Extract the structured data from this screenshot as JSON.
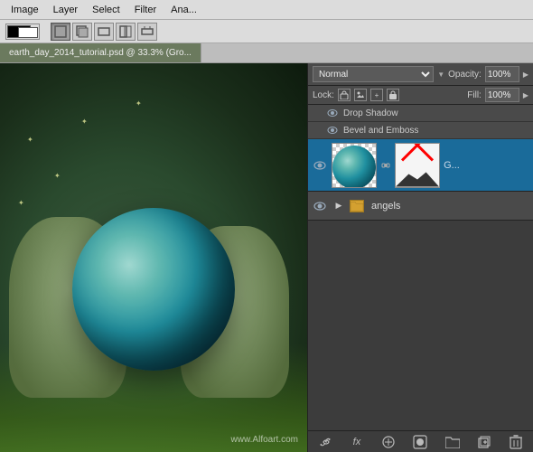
{
  "menubar": {
    "items": [
      "Image",
      "Layer",
      "Select",
      "Filter",
      "Ana..."
    ]
  },
  "options": {
    "swatch_label": "Swatches",
    "tool_buttons": [
      "rect1",
      "rect2",
      "rect3",
      "rect4",
      "rect5"
    ]
  },
  "tab": {
    "label": "earth_day_2014_tutorial.psd @ 33.3% (Gro..."
  },
  "layers_panel": {
    "blend_mode": "Normal",
    "opacity_label": "Opacity:",
    "opacity_value": "100%",
    "lock_label": "Lock:",
    "fill_label": "Fill:",
    "fill_value": "100%",
    "effects": [
      {
        "name": "Drop Shadow"
      },
      {
        "name": "Bevel and Emboss"
      }
    ],
    "layers": [
      {
        "id": "globe-layer",
        "visible": true,
        "type": "image",
        "name": "",
        "has_extra_thumb": true,
        "selected": true
      },
      {
        "id": "angels-layer",
        "visible": true,
        "type": "folder",
        "name": "angels",
        "selected": false
      }
    ],
    "toolbar_icons": [
      "link",
      "fx",
      "adjustment",
      "mask",
      "folder",
      "new",
      "trash"
    ]
  },
  "watermark": {
    "text": "www.Alfoart.com"
  },
  "scene": {
    "sparkles": [
      "✦",
      "✦",
      "✦",
      "✦",
      "✦"
    ]
  }
}
